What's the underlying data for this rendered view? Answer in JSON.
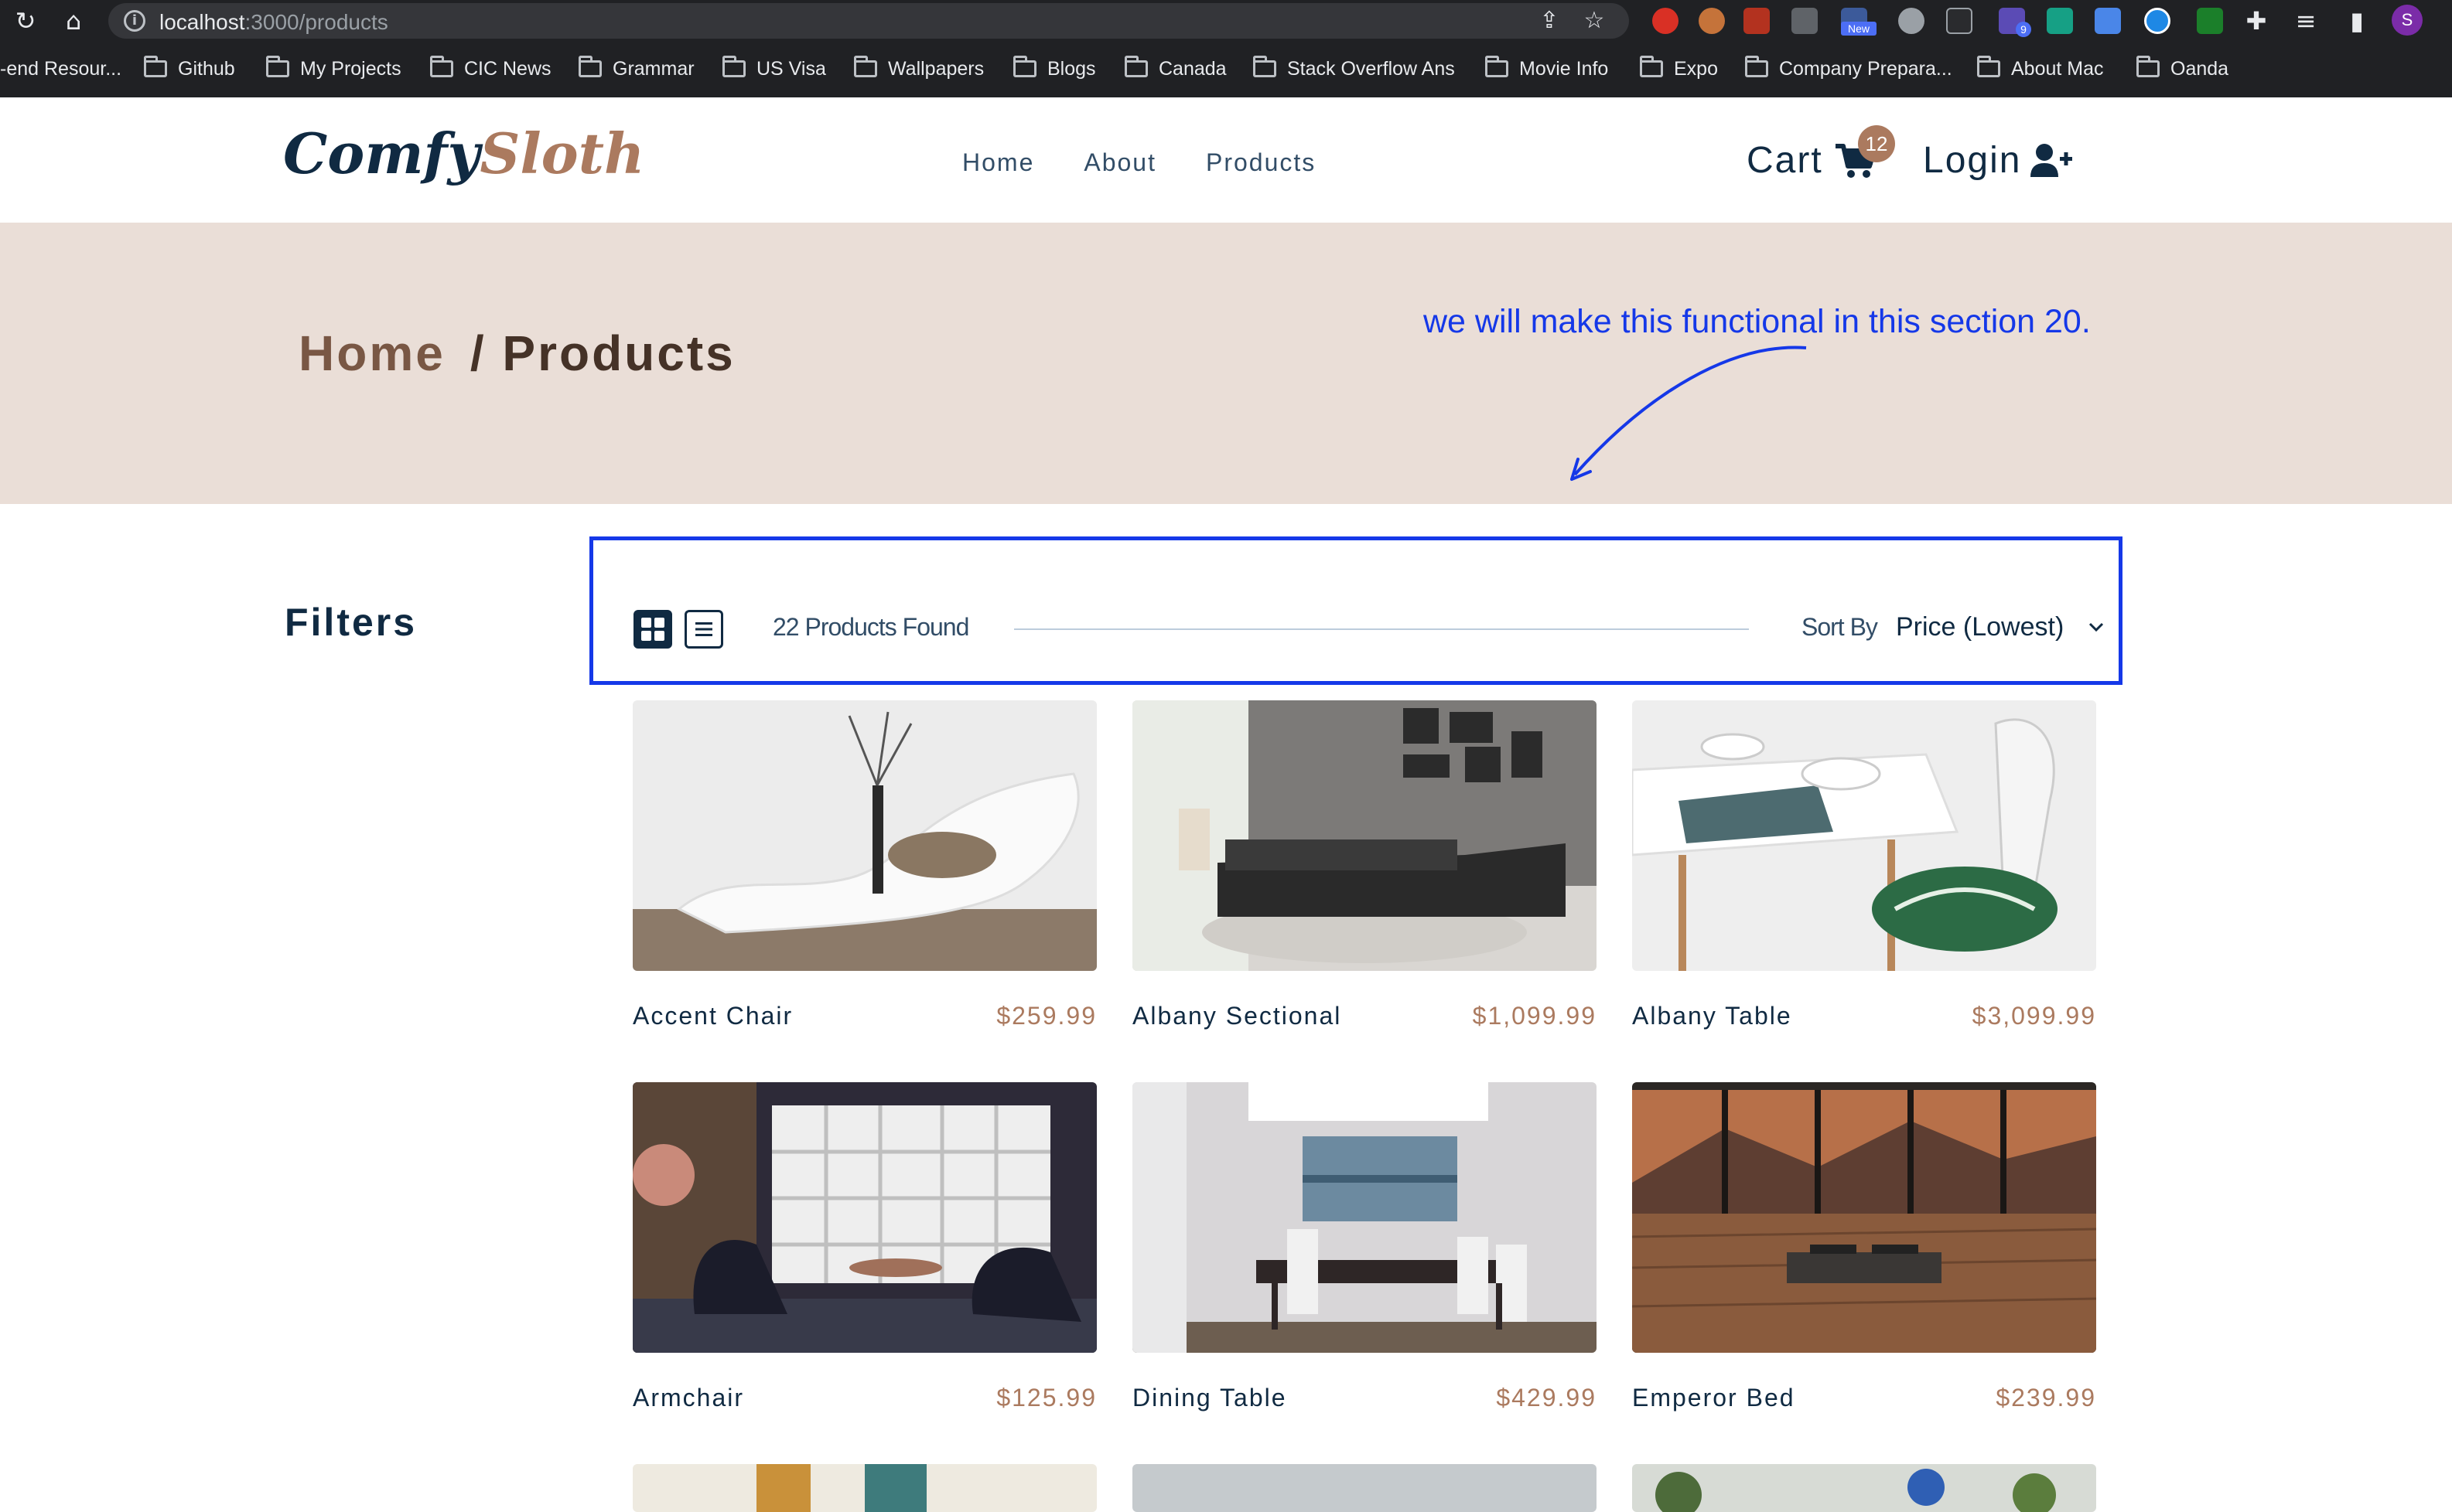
{
  "browser": {
    "url_host": "localhost",
    "url_path": ":3000/products",
    "ext_new_label": "New",
    "ext_badge_count": "9",
    "profile_initial": "S",
    "bookmarks": [
      "-end Resour...",
      "Github",
      "My Projects",
      "CIC News",
      "Grammar",
      "US Visa",
      "Wallpapers",
      "Blogs",
      "Canada",
      "Stack Overflow Ans",
      "Movie Info",
      "Expo",
      "Company Prepara...",
      "About Mac",
      "Oanda"
    ]
  },
  "site": {
    "logo_part1": "Comfy",
    "logo_part2": "Sloth",
    "nav": [
      "Home",
      "About",
      "Products"
    ],
    "cart_label": "Cart",
    "cart_count": "12",
    "login_label": "Login",
    "colors": {
      "brand": "#ab7a5f",
      "dark": "#102a42",
      "hero_bg": "#eaded7",
      "annotation": "#1538e8"
    }
  },
  "hero": {
    "crumb_home": "Home",
    "crumb_current": "/ Products"
  },
  "annotation": {
    "text": "we will make this functional in this section 20."
  },
  "filters": {
    "title": "Filters"
  },
  "sort": {
    "products_found": "22 Products Found",
    "sort_label": "Sort By",
    "selected": "Price (Lowest)"
  },
  "products": [
    {
      "name": "Accent Chair",
      "price": "$259.99"
    },
    {
      "name": "Albany Sectional",
      "price": "$1,099.99"
    },
    {
      "name": "Albany Table",
      "price": "$3,099.99"
    },
    {
      "name": "Armchair",
      "price": "$125.99"
    },
    {
      "name": "Dining Table",
      "price": "$429.99"
    },
    {
      "name": "Emperor Bed",
      "price": "$239.99"
    }
  ]
}
